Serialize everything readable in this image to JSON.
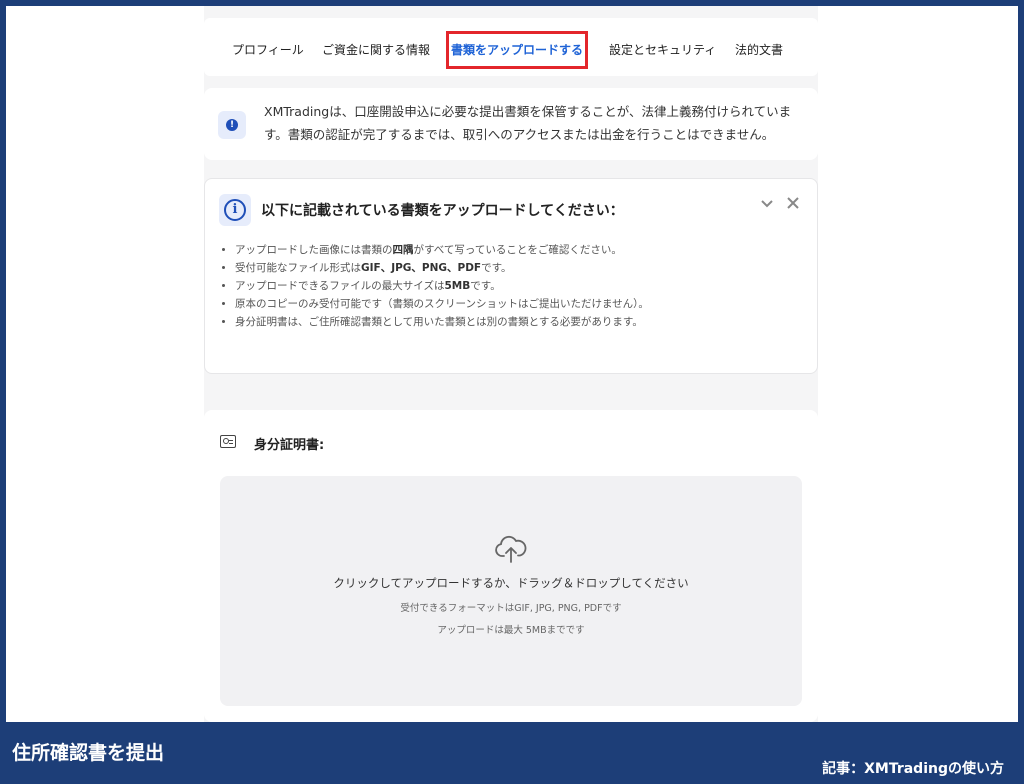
{
  "tabs": [
    {
      "label": "プロフィール"
    },
    {
      "label": "ご資金に関する情報"
    },
    {
      "label": "書類をアップロードする",
      "active": true
    },
    {
      "label": "設定とセキュリティ"
    },
    {
      "label": "法的文書"
    }
  ],
  "notice": {
    "text": "XMTradingは、口座開設申込に必要な提出書類を保管することが、法律上義務付けられています。書類の認証が完了するまでは、取引へのアクセスまたは出金を行うことはできません。",
    "icon": "alert-icon"
  },
  "instructions": {
    "title": "以下に記載されている書類をアップロードしてください：",
    "items": [
      {
        "pre": "アップロードした画像には書類の",
        "bold": "四隅",
        "post": "がすべて写っていることをご確認ください。"
      },
      {
        "pre": "受付可能なファイル形式は",
        "bold": "GIF、JPG、PNG、PDF",
        "post": "です。"
      },
      {
        "pre": "アップロードできるファイルの最大サイズは",
        "bold": "5MB",
        "post": "です。"
      },
      {
        "pre": "原本のコピーのみ受付可能です（書類のスクリーンショットはご提出いただけません）。",
        "bold": "",
        "post": ""
      },
      {
        "pre": "身分証明書は、ご住所確認書類として用いた書類とは別の書類とする必要があります。",
        "bold": "",
        "post": ""
      }
    ]
  },
  "id_section": {
    "label": "身分証明書:",
    "dropzone": {
      "main": "クリックしてアップロードするか、ドラッグ＆ドロップしてください",
      "formats": "受付できるフォーマットはGIF, JPG, PNG, PDFです",
      "max": "アップロードは最大 5MBまでです"
    }
  },
  "footer": {
    "caption": "住所確認書を提出",
    "article": "記事：XMTradingの使い方"
  },
  "colors": {
    "accent": "#1f63d6",
    "highlight": "#e3262b",
    "banner": "#1d3e78"
  }
}
